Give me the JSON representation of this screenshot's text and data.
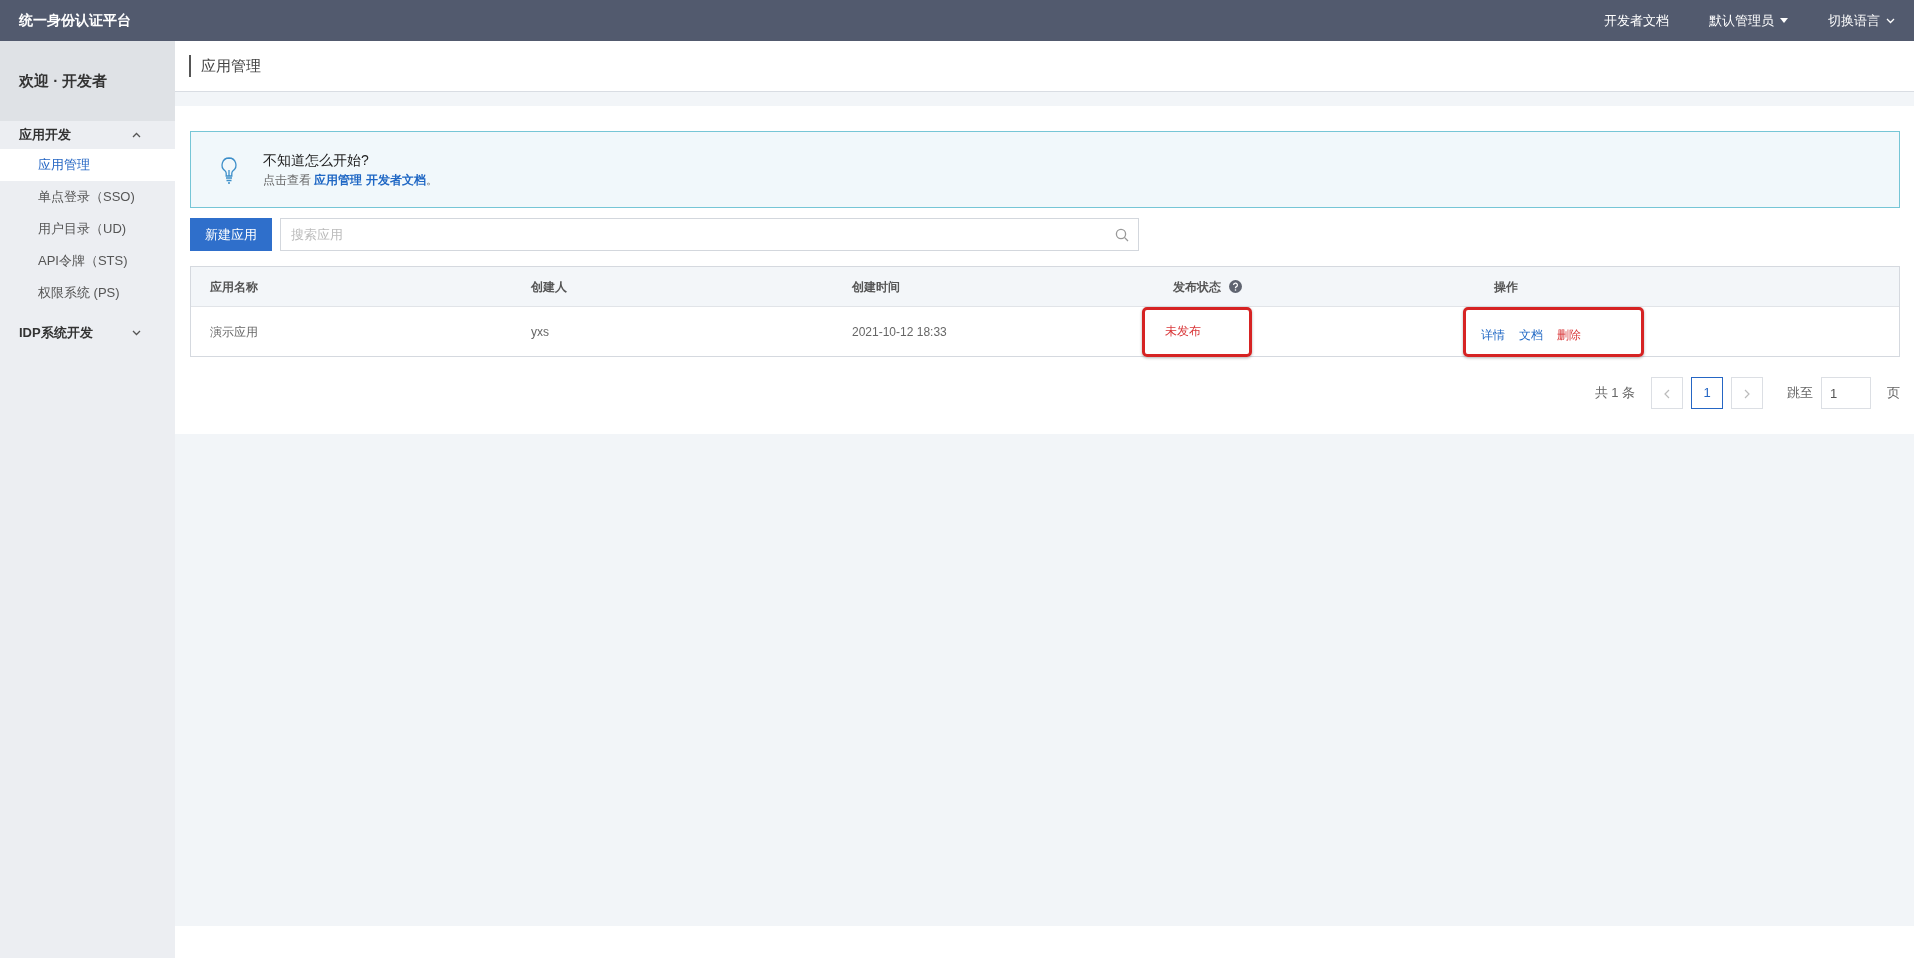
{
  "topbar": {
    "title": "统一身份认证平台",
    "links": [
      {
        "label": "开发者文档",
        "kind": "link"
      },
      {
        "label": "默认管理员",
        "kind": "dropdown"
      },
      {
        "label": "切换语言",
        "kind": "chevron"
      }
    ]
  },
  "sidebar": {
    "welcome": "欢迎 · 开发者",
    "groups": [
      {
        "label": "应用开发",
        "expanded": true,
        "children": [
          {
            "label": "应用管理",
            "selected": true
          },
          {
            "label": "单点登录（SSO)",
            "selected": false
          },
          {
            "label": "用户目录（UD)",
            "selected": false
          },
          {
            "label": "API令牌（STS)",
            "selected": false
          },
          {
            "label": "权限系统 (PS)",
            "selected": false
          }
        ]
      },
      {
        "label": "IDP系统开发",
        "expanded": false
      }
    ]
  },
  "page_title": "应用管理",
  "tip": {
    "title": "不知道怎么开始?",
    "prefix": "点击查看 ",
    "link": "应用管理 开发者文档",
    "suffix": "。"
  },
  "toolbar": {
    "button": "新建应用",
    "search": {
      "placeholder": "搜索应用"
    }
  },
  "table": {
    "columns": [
      {
        "label": "应用名称",
        "help": false
      },
      {
        "label": "创建人",
        "help": false
      },
      {
        "label": "创建时间",
        "help": false
      },
      {
        "label": "发布状态",
        "help": true
      },
      {
        "label": "操作",
        "help": false
      }
    ],
    "rows": [
      {
        "cells": [
          "演示应用",
          "yxs",
          "2021-10-12 18:33"
        ],
        "status": {
          "text": "未发布",
          "published": false,
          "highlighted": true
        },
        "actions_highlighted": true,
        "actions": [
          {
            "label": "详情",
            "kind": "normal"
          },
          {
            "label": "文档",
            "kind": "normal"
          },
          {
            "label": "删除",
            "kind": "danger"
          }
        ]
      }
    ]
  },
  "pagination": {
    "total": "共 1 条",
    "pages": [
      {
        "label": "1",
        "selected": true
      }
    ],
    "jump_label": "跳至",
    "jump_value": "1",
    "page_unit": "页"
  }
}
